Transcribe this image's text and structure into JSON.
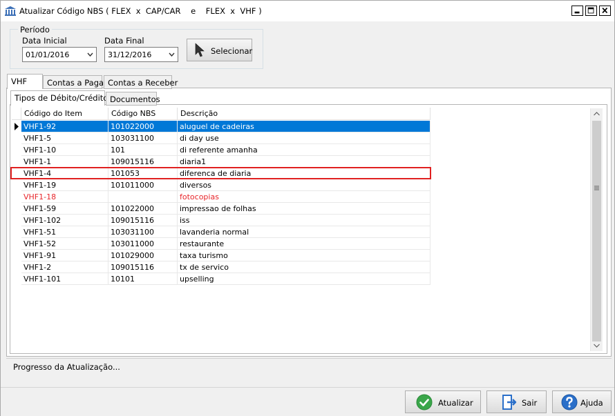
{
  "window": {
    "title": "Atualizar Código NBS ( FLEX  x  CAP/CAR    e    FLEX  x  VHF )",
    "icon": "bank-icon"
  },
  "periodo": {
    "legend": "Período",
    "data_inicial_label": "Data Inicial",
    "data_inicial_value": "01/01/2016",
    "data_final_label": "Data Final",
    "data_final_value": "31/12/2016",
    "selecionar_label": "Selecionar",
    "selecionar_icon": "cursor-arrow-icon"
  },
  "tabs": [
    {
      "label": "VHF",
      "active": true
    },
    {
      "label": "Contas a Pagar",
      "active": false
    },
    {
      "label": "Contas a Receber",
      "active": false
    }
  ],
  "subtabs": [
    {
      "label": "Tipos de Débito/Crédito",
      "active": true
    },
    {
      "label": "Documentos",
      "active": false
    }
  ],
  "grid": {
    "columns": [
      "Código do Item",
      "Código NBS",
      "Descrição"
    ],
    "rows": [
      {
        "item": "VHF1-92",
        "nbs": "101022000",
        "desc": "aluguel de cadeiras",
        "state": "selected"
      },
      {
        "item": "VHF1-5",
        "nbs": "103031100",
        "desc": "di day use",
        "state": "normal"
      },
      {
        "item": "VHF1-10",
        "nbs": "101",
        "desc": "di referente amanha",
        "state": "normal"
      },
      {
        "item": "VHF1-1",
        "nbs": "109015116",
        "desc": "diaria1",
        "state": "normal"
      },
      {
        "item": "VHF1-4",
        "nbs": "101053",
        "desc": "diferenca de diaria",
        "state": "highlighted"
      },
      {
        "item": "VHF1-19",
        "nbs": "101011000",
        "desc": "diversos",
        "state": "normal"
      },
      {
        "item": "VHF1-18",
        "nbs": "",
        "desc": "fotocopias",
        "state": "red"
      },
      {
        "item": "VHF1-59",
        "nbs": "101022000",
        "desc": "impressao de folhas",
        "state": "normal"
      },
      {
        "item": "VHF1-102",
        "nbs": "109015116",
        "desc": "iss",
        "state": "normal"
      },
      {
        "item": "VHF1-51",
        "nbs": "103031100",
        "desc": "lavanderia normal",
        "state": "normal"
      },
      {
        "item": "VHF1-52",
        "nbs": "103011000",
        "desc": "restaurante",
        "state": "normal"
      },
      {
        "item": "VHF1-91",
        "nbs": "101029000",
        "desc": "taxa turismo",
        "state": "normal"
      },
      {
        "item": "VHF1-2",
        "nbs": "109015116",
        "desc": "tx de servico",
        "state": "normal"
      },
      {
        "item": "VHF1-101",
        "nbs": "10101",
        "desc": "upselling",
        "state": "normal"
      }
    ]
  },
  "progress": {
    "label": "Progresso da Atualização..."
  },
  "footer": {
    "atualizar_label": "Atualizar",
    "sair_label": "Sair",
    "ajuda_label": "Ajuda"
  },
  "colors": {
    "selection": "#0078d7",
    "highlight_border": "#e02020",
    "error_text": "#e8252a",
    "ok_green": "#3aa64a",
    "help_blue": "#2a6fc9"
  }
}
